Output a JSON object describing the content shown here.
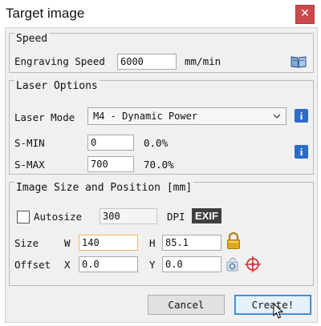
{
  "window": {
    "title": "Target image",
    "close_glyph": "✕"
  },
  "speed": {
    "group_title": "Speed",
    "engraving_speed_label": "Engraving Speed",
    "engraving_speed_value": "6000",
    "unit": "mm/min",
    "help_icon": "book-icon"
  },
  "laser": {
    "group_title": "Laser Options",
    "mode_label": "Laser Mode",
    "mode_value": "M4 - Dynamic Power",
    "smin_label": "S-MIN",
    "smin_value": "0",
    "smin_percent": "0.0%",
    "smax_label": "S-MAX",
    "smax_value": "700",
    "smax_percent": "70.0%",
    "info_glyph": "i"
  },
  "image": {
    "group_title": "Image Size and Position [mm]",
    "autosize_label": "Autosize",
    "autosize_checked": false,
    "dpi_value": "300",
    "dpi_label": "DPI",
    "exif_label": "EXIF",
    "size_label": "Size",
    "w_label": "W",
    "w_value": "140",
    "h_label": "H",
    "h_value": "85.1",
    "offset_label": "Offset",
    "x_label": "X",
    "x_value": "0.0",
    "y_label": "Y",
    "y_value": "0.0"
  },
  "buttons": {
    "cancel": "Cancel",
    "create": "Create!"
  },
  "colors": {
    "info_blue": "#2a6cc7",
    "lock_gold": "#e0a71c",
    "close_red": "#c94a4a",
    "target_red": "#d0343c"
  }
}
